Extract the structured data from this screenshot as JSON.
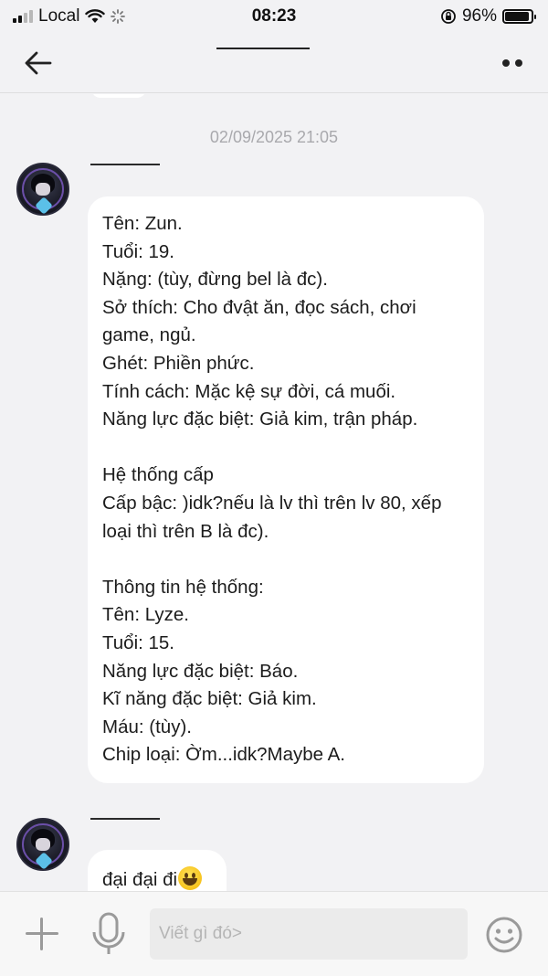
{
  "status_bar": {
    "carrier": "Local",
    "time": "08:23",
    "battery": "96%",
    "battery_level": 0.96
  },
  "nav": {
    "back_icon": "arrow-left-icon",
    "more_icon": "more-dots-icon"
  },
  "chat": {
    "timestamp": "02/09/2025 21:05",
    "messages": [
      {
        "lines": [
          "Tên: Zun.",
          "Tuổi: 19.",
          "Nặng: (tùy, đừng bel là đc).",
          "Sở thích: Cho đvật ăn, đọc sách, chơi",
          "game, ngủ.",
          "Ghét: Phiền phức.",
          "Tính cách: Mặc kệ sự đời, cá muối.",
          "Năng lực đặc biệt: Giả kim, trận pháp.",
          "",
          "Hệ thống cấp",
          "Cấp bậc: )idk?nếu là lv thì trên lv 80, xếp",
          "loại thì trên B là đc).",
          "",
          "Thông tin hệ thống:",
          "Tên: Lyze.",
          "Tuổi: 15.",
          "Năng lực đặc biệt: Báo.",
          "Kĩ năng đặc biệt: Giả kim.",
          "Máu: (tùy).",
          "Chip loại: Ờm...idk?Maybe A."
        ]
      },
      {
        "text": "đại đại đi",
        "emoji": "grinning-face-emoji"
      }
    ]
  },
  "input_bar": {
    "placeholder": "Viết gì đó>",
    "value": ""
  },
  "colors": {
    "background": "#f2f2f4",
    "bubble": "#ffffff",
    "timestamp": "#a9a9ad"
  }
}
